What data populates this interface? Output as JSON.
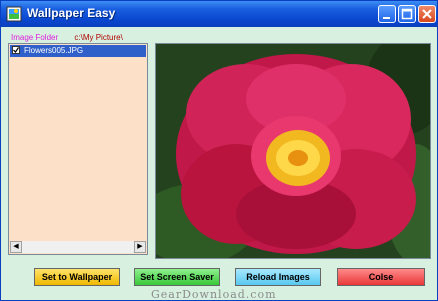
{
  "window": {
    "title": "Wallpaper Easy"
  },
  "folder": {
    "label": "Image Folder",
    "path": "c:\\My Picture\\"
  },
  "list": {
    "items": [
      {
        "label": "Flowers005.JPG",
        "checked": true
      }
    ]
  },
  "buttons": {
    "set_wallpaper": "Set to Wallpaper",
    "set_screensaver": "Set Screen Saver",
    "reload": "Reload Images",
    "close": "Colse"
  },
  "watermark": "GearDownload.com",
  "colors": {
    "titlebar": "#0a48d0",
    "window_bg": "#d8f0e0",
    "list_bg": "#fde0c8",
    "selection": "#2f5fc8"
  }
}
